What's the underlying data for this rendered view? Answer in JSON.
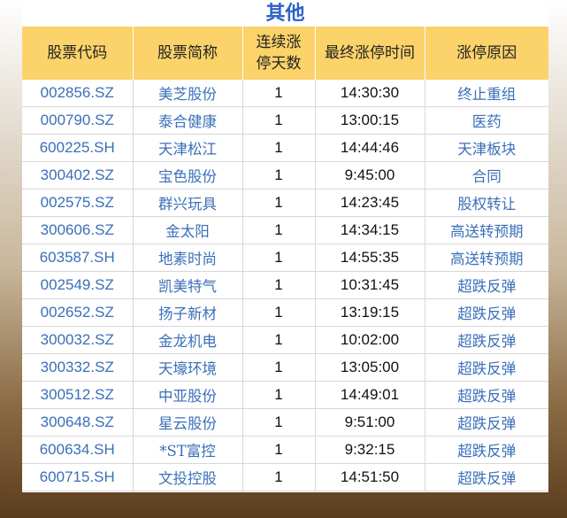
{
  "title": "其他",
  "headers": {
    "code": "股票代码",
    "name": "股票简称",
    "days_line1": "连续涨",
    "days_line2": "停天数",
    "time": "最终涨停时间",
    "reason": "涨停原因"
  },
  "rows": [
    {
      "code": "002856.SZ",
      "name": "美芝股份",
      "days": "1",
      "time": "14:30:30",
      "reason": "终止重组"
    },
    {
      "code": "000790.SZ",
      "name": "泰合健康",
      "days": "1",
      "time": "13:00:15",
      "reason": "医药"
    },
    {
      "code": "600225.SH",
      "name": "天津松江",
      "days": "1",
      "time": "14:44:46",
      "reason": "天津板块"
    },
    {
      "code": "300402.SZ",
      "name": "宝色股份",
      "days": "1",
      "time": "9:45:00",
      "reason": "合同"
    },
    {
      "code": "002575.SZ",
      "name": "群兴玩具",
      "days": "1",
      "time": "14:23:45",
      "reason": "股权转让"
    },
    {
      "code": "300606.SZ",
      "name": "金太阳",
      "days": "1",
      "time": "14:34:15",
      "reason": "高送转预期"
    },
    {
      "code": "603587.SH",
      "name": "地素时尚",
      "days": "1",
      "time": "14:55:35",
      "reason": "高送转预期"
    },
    {
      "code": "002549.SZ",
      "name": "凯美特气",
      "days": "1",
      "time": "10:31:45",
      "reason": "超跌反弹"
    },
    {
      "code": "002652.SZ",
      "name": "扬子新材",
      "days": "1",
      "time": "13:19:15",
      "reason": "超跌反弹"
    },
    {
      "code": "300032.SZ",
      "name": "金龙机电",
      "days": "1",
      "time": "10:02:00",
      "reason": "超跌反弹"
    },
    {
      "code": "300332.SZ",
      "name": "天壕环境",
      "days": "1",
      "time": "13:05:00",
      "reason": "超跌反弹"
    },
    {
      "code": "300512.SZ",
      "name": "中亚股份",
      "days": "1",
      "time": "14:49:01",
      "reason": "超跌反弹"
    },
    {
      "code": "300648.SZ",
      "name": "星云股份",
      "days": "1",
      "time": "9:51:00",
      "reason": "超跌反弹"
    },
    {
      "code": "600634.SH",
      "name": "*ST富控",
      "days": "1",
      "time": "9:32:15",
      "reason": "超跌反弹"
    },
    {
      "code": "600715.SH",
      "name": "文投控股",
      "days": "1",
      "time": "14:51:50",
      "reason": "超跌反弹"
    }
  ],
  "colors": {
    "title": "#2e62c6",
    "header_bg": "#fbd36a",
    "link_text": "#3a6fb8"
  }
}
